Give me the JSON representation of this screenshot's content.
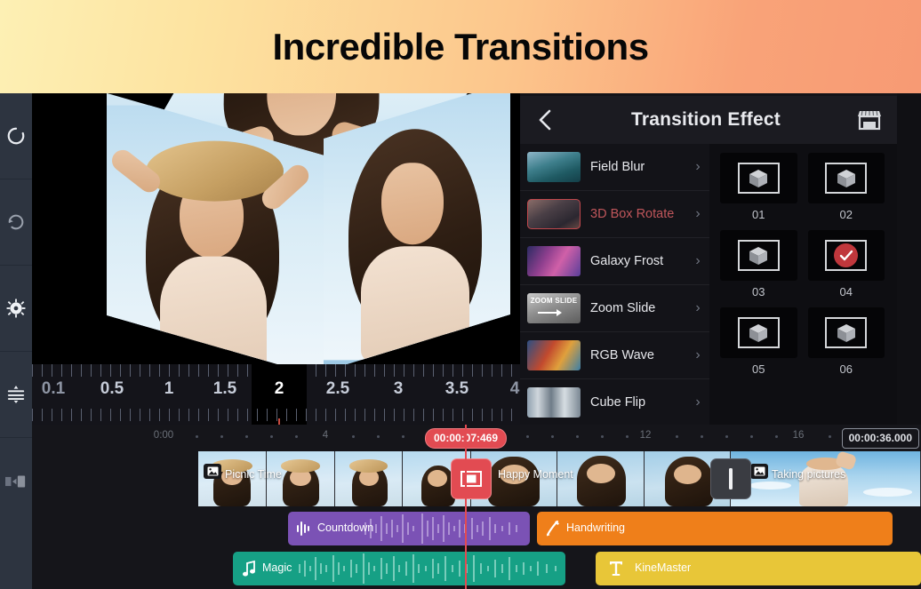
{
  "banner": {
    "title": "Incredible Transitions"
  },
  "rail": {
    "items": [
      {
        "name": "undo-button",
        "icon": "undo-icon"
      },
      {
        "name": "redo-button",
        "icon": "redo-icon"
      },
      {
        "name": "settings-button",
        "icon": "gear-icon"
      },
      {
        "name": "mixer-button",
        "icon": "sliders-icon"
      },
      {
        "name": "export-button",
        "icon": "export-icon"
      }
    ]
  },
  "preview": {
    "effect": "3D Box Rotate preview",
    "zoom_ruler": {
      "labels": [
        "0.1",
        "0.5",
        "1",
        "1.5",
        "2",
        "2.5",
        "3",
        "3.5",
        "4"
      ],
      "current": "2"
    }
  },
  "panel": {
    "title": "Transition Effect",
    "back_icon": "chevron-left-icon",
    "store_icon": "store-icon",
    "effects": [
      {
        "label": "Field Blur",
        "thumb": "t-field",
        "selected": false
      },
      {
        "label": "3D Box Rotate",
        "thumb": "t-box",
        "selected": true
      },
      {
        "label": "Galaxy Frost",
        "thumb": "t-galaxy",
        "selected": false
      },
      {
        "label": "Zoom Slide",
        "thumb": "t-zoom",
        "selected": false,
        "thumb_text": "ZOOM SLIDE"
      },
      {
        "label": "RGB Wave",
        "thumb": "t-rgb",
        "selected": false
      },
      {
        "label": "Cube Flip",
        "thumb": "t-cube",
        "selected": false
      }
    ],
    "variants": [
      {
        "label": "01",
        "selected": false
      },
      {
        "label": "02",
        "selected": false
      },
      {
        "label": "03",
        "selected": false
      },
      {
        "label": "04",
        "selected": true
      },
      {
        "label": "05",
        "selected": false
      },
      {
        "label": "06",
        "selected": false
      }
    ]
  },
  "timeline": {
    "start_label": "0:00",
    "tick_labels": [
      "4",
      "12",
      "16"
    ],
    "current_time": "00:00:07:469",
    "total_time": "00:00:36.000",
    "video_clips": [
      {
        "label": "Picnic Time",
        "badge": "image-icon"
      },
      {
        "label": "Happy Moment",
        "badge": ""
      },
      {
        "label": "Taking pictures",
        "badge": "image-icon"
      }
    ],
    "transitions": [
      {
        "type": "selected",
        "icon": "transition-box-icon"
      },
      {
        "type": "normal",
        "icon": "transition-bar-icon"
      }
    ],
    "audio_tracks": [
      {
        "label": "Countdown",
        "color": "#7b52b5",
        "icon": "audio-wave-icon"
      },
      {
        "label": "Handwriting",
        "color": "#ef7f1a",
        "icon": "pen-icon"
      },
      {
        "label": "Magic",
        "color": "#16a085",
        "icon": "music-note-icon"
      },
      {
        "label": "KineMaster",
        "color": "#e8c638",
        "icon": "text-t-icon"
      }
    ]
  },
  "colors": {
    "accent_red": "#e24b52",
    "banner_start": "#fdf0b4",
    "banner_end": "#f79a74",
    "rail_bg": "#2d3440"
  }
}
